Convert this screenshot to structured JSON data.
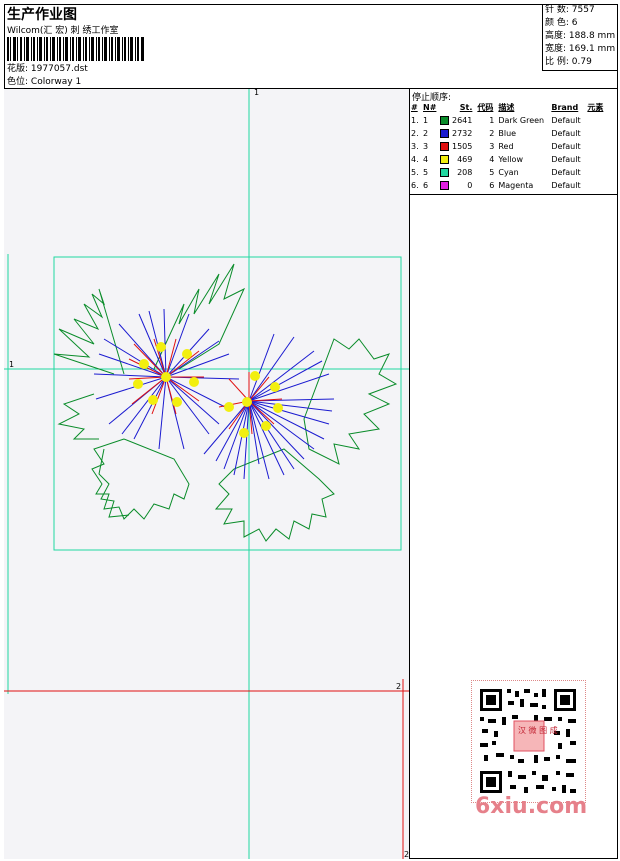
{
  "header": {
    "title": "生产作业图",
    "subtitle": "Wilcom(汇 宏) 刺 绣工作室",
    "design_label": "花版:",
    "design_value": "1977057.dst",
    "colorway_label": "色位:",
    "colorway_value": "Colorway 1"
  },
  "stats": [
    {
      "label": "针 数:",
      "value": "7557"
    },
    {
      "label": "颜 色:",
      "value": "6"
    },
    {
      "label": "高度:",
      "value": "188.8 mm"
    },
    {
      "label": "宽度:",
      "value": "169.1 mm"
    },
    {
      "label": "比 例:",
      "value": "0.79"
    }
  ],
  "sequence": {
    "title": "停止顺序:",
    "headers": {
      "idx": "#",
      "num": "N#",
      "st": "St.",
      "code": "代码",
      "desc": "描述",
      "brand": "Brand",
      "elem": "元素"
    },
    "rows": [
      {
        "idx": "1.",
        "num": "1",
        "color": "#0a8c2a",
        "st": "2641",
        "code": "1",
        "desc": "Dark Green",
        "brand": "Default"
      },
      {
        "idx": "2.",
        "num": "2",
        "color": "#1b1bd0",
        "st": "2732",
        "code": "2",
        "desc": "Blue",
        "brand": "Default"
      },
      {
        "idx": "3.",
        "num": "3",
        "color": "#e01010",
        "st": "1505",
        "code": "3",
        "desc": "Red",
        "brand": "Default"
      },
      {
        "idx": "4.",
        "num": "4",
        "color": "#f2ef10",
        "st": "469",
        "code": "4",
        "desc": "Yellow",
        "brand": "Default"
      },
      {
        "idx": "5.",
        "num": "5",
        "color": "#20d8a0",
        "st": "208",
        "code": "5",
        "desc": "Cyan",
        "brand": "Default"
      },
      {
        "idx": "6.",
        "num": "6",
        "color": "#e020e0",
        "st": "0",
        "code": "6",
        "desc": "Magenta",
        "brand": "Default"
      }
    ]
  },
  "canvas": {
    "marker_top": "1",
    "marker_left": "1",
    "marker_right": "2",
    "marker_bottom": "2"
  },
  "watermark": "6xiu.com",
  "qr_stamp": "汉 微 图 成"
}
